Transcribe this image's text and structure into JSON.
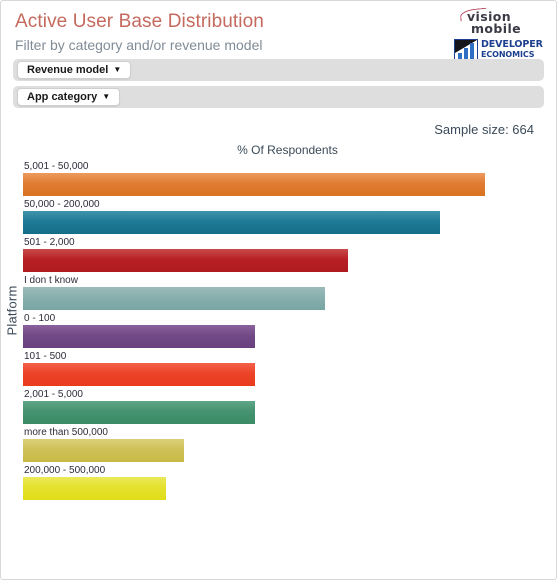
{
  "header": {
    "title": "Active User Base Distribution",
    "subtitle": "Filter by category and/or revenue model",
    "logos": {
      "vision_line1": "vision",
      "vision_line2": "mobile",
      "developer_line1": "DEVELOPER",
      "developer_line2": "ECONOMICS"
    }
  },
  "filters": [
    {
      "label": "Revenue model",
      "caret": "▼"
    },
    {
      "label": "App category",
      "caret": "▼"
    }
  ],
  "stats": {
    "sample_size_label": "Sample size:",
    "sample_size_value": "664",
    "sample_size_text": "Sample size:  664"
  },
  "chart_data": {
    "type": "bar",
    "orientation": "horizontal",
    "title": "% Of Respondents",
    "xlabel": "% Of Respondents",
    "ylabel": "Platform",
    "grid": false,
    "legend": false,
    "sample_size": 664,
    "xlim": [
      0,
      25
    ],
    "categories": [
      "5,001 - 50,000",
      "50,000 - 200,000",
      "501 - 2,000",
      "I don t know",
      "0 - 100",
      "101 - 500",
      "2,001 - 5,000",
      "more than 500,000",
      "200,000 - 500,000"
    ],
    "values": [
      23.3,
      21.0,
      16.4,
      15.2,
      11.7,
      11.7,
      11.7,
      8.1,
      7.2
    ],
    "colors": [
      "#e07b33",
      "#1f7b96",
      "#b72025",
      "#87afae",
      "#724a86",
      "#ec4429",
      "#459370",
      "#cfc157",
      "#e4e12d"
    ],
    "bars": [
      {
        "label": "5,001 - 50,000",
        "value": 23.3,
        "color": "#e07b33",
        "color_top": "#ed9a5c",
        "color_bottom": "#d9731f"
      },
      {
        "label": "50,000 - 200,000",
        "value": 21.0,
        "color": "#1f7b96",
        "color_top": "#3e93aa",
        "color_bottom": "#166d87"
      },
      {
        "label": "501 - 2,000",
        "value": 16.4,
        "color": "#b72025",
        "color_top": "#c84a4a",
        "color_bottom": "#ae1b20"
      },
      {
        "label": "I don t know",
        "value": 15.2,
        "color": "#87afae",
        "color_top": "#9cbcba",
        "color_bottom": "#78a5a3"
      },
      {
        "label": "0 - 100",
        "value": 11.7,
        "color": "#724a86",
        "color_top": "#8a619c",
        "color_bottom": "#6a4080"
      },
      {
        "label": "101 - 500",
        "value": 11.7,
        "color": "#ec4429",
        "color_top": "#f4604a",
        "color_bottom": "#e93a1d"
      },
      {
        "label": "2,001 - 5,000",
        "value": 11.7,
        "color": "#459370",
        "color_top": "#5fa687",
        "color_bottom": "#3a8b66"
      },
      {
        "label": "more than 500,000",
        "value": 8.1,
        "color": "#cfc157",
        "color_top": "#dbd07a",
        "color_bottom": "#c9ba45"
      },
      {
        "label": "200,000 - 500,000",
        "value": 7.2,
        "color": "#e4e12d",
        "color_top": "#ebe95a",
        "color_bottom": "#e0dd19"
      }
    ]
  }
}
